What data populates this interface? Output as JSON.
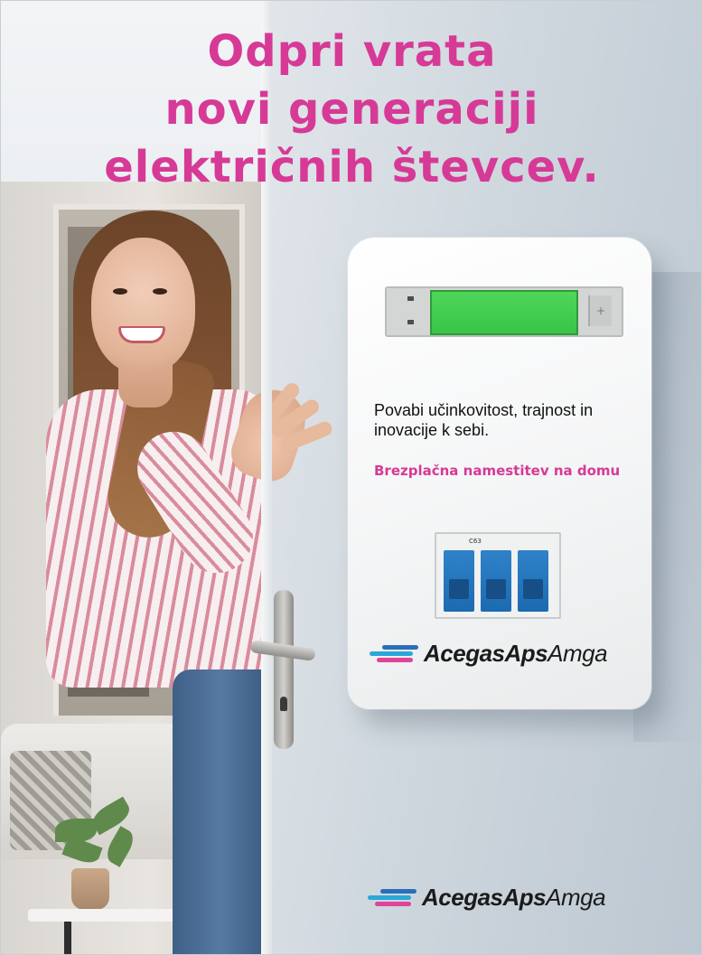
{
  "headline": {
    "lines": [
      "Odpri vrata",
      "novi generaciji",
      "električnih števcev."
    ]
  },
  "meter": {
    "body_text": "Povabi učinkovitost, trajnost in inovacije k sebi.",
    "cta_text": "Brezplačna namestitev na domu",
    "breaker_label": "C63",
    "brand": {
      "part_bold_1": "Acegas",
      "part_bold_2": "Aps",
      "part_regular": "Amga"
    }
  },
  "footer_brand": {
    "part_bold_1": "Acegas",
    "part_bold_2": "Aps",
    "part_regular": "Amga"
  },
  "colors": {
    "accent_magenta": "#d63a96",
    "logo_cyan": "#2aa7d9",
    "logo_pink": "#e0439a",
    "logo_blue": "#2c6fb8",
    "display_green": "#4fd65a"
  }
}
